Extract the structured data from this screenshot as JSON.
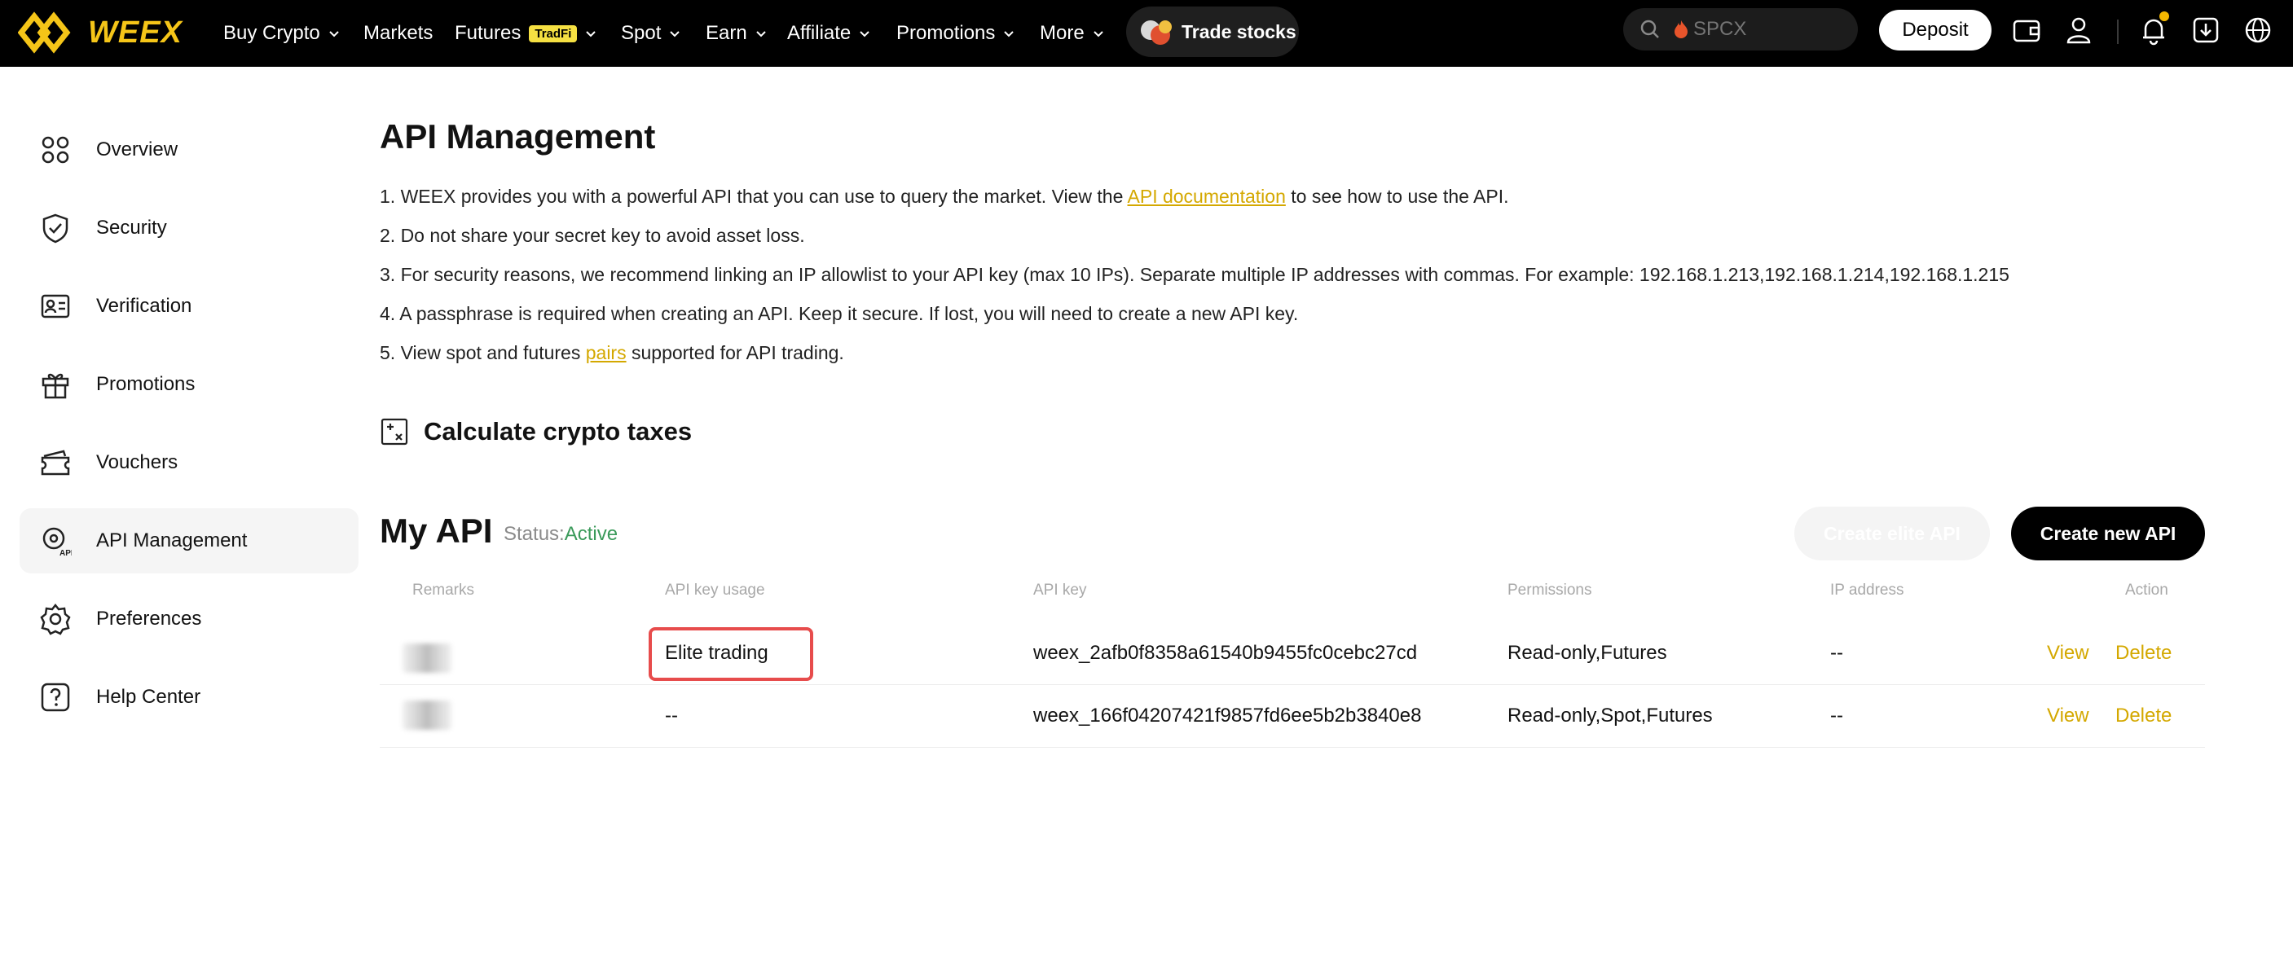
{
  "brand": {
    "name": "WEEX",
    "accent": "#F5C518"
  },
  "nav": {
    "items": [
      {
        "label": "Buy Crypto",
        "dropdown": true
      },
      {
        "label": "Markets",
        "dropdown": false
      },
      {
        "label": "Futures",
        "dropdown": true,
        "badge": "TradFi"
      },
      {
        "label": "Spot",
        "dropdown": true
      },
      {
        "label": "Earn",
        "dropdown": true
      },
      {
        "label": "Affiliate",
        "dropdown": true
      },
      {
        "label": "Promotions",
        "dropdown": true
      },
      {
        "label": "More",
        "dropdown": true
      }
    ],
    "trade_stocks": "Trade stocks",
    "search_placeholder": "SPCX",
    "deposit": "Deposit",
    "right_icons": [
      "wallet-icon",
      "user-icon",
      "bell-icon",
      "download-icon",
      "globe-icon"
    ]
  },
  "sidebar": {
    "items": [
      {
        "label": "Overview",
        "icon": "overview-icon"
      },
      {
        "label": "Security",
        "icon": "shield-icon"
      },
      {
        "label": "Verification",
        "icon": "id-card-icon"
      },
      {
        "label": "Promotions",
        "icon": "gift-icon"
      },
      {
        "label": "Vouchers",
        "icon": "voucher-icon"
      },
      {
        "label": "API Management",
        "icon": "api-icon",
        "active": true
      },
      {
        "label": "Preferences",
        "icon": "gear-icon"
      },
      {
        "label": "Help Center",
        "icon": "help-icon"
      }
    ]
  },
  "main": {
    "title": "API Management",
    "info": [
      {
        "before": "1. WEEX provides you with a powerful API that you can use to query the market. View the ",
        "link": "API documentation",
        "after": " to see how to use the API."
      },
      {
        "before": "2. Do not share your secret key to avoid asset loss.",
        "link": "",
        "after": ""
      },
      {
        "before": "3. For security reasons, we recommend linking an IP allowlist to your API key (max 10 IPs). Separate multiple IP addresses with commas. For example: 192.168.1.213,192.168.1.214,192.168.1.215",
        "link": "",
        "after": ""
      },
      {
        "before": "4. A passphrase is required when creating an API. Keep it secure. If lost, you will need to create a new API key.",
        "link": "",
        "after": ""
      },
      {
        "before": "5. View spot and futures ",
        "link": "pairs",
        "after": " supported for API trading."
      }
    ],
    "calc_taxes": "Calculate crypto taxes",
    "my_api": {
      "title": "My API",
      "status_label": "Status:",
      "status_value": "Active",
      "create_elite": "Create elite API",
      "create_new": "Create new API",
      "columns": [
        "Remarks",
        "API key usage",
        "API key",
        "Permissions",
        "IP address",
        "Action"
      ],
      "rows": [
        {
          "usage": "Elite trading",
          "key": "weex_2afb0f8358a61540b9455fc0cebc27cd",
          "permissions": "Read-only,Futures",
          "ip": "--",
          "view": "View",
          "delete": "Delete"
        },
        {
          "usage": "--",
          "key": "weex_166f04207421f9857fd6ee5b2b3840e8",
          "permissions": "Read-only,Spot,Futures",
          "ip": "--",
          "view": "View",
          "delete": "Delete"
        }
      ]
    }
  }
}
